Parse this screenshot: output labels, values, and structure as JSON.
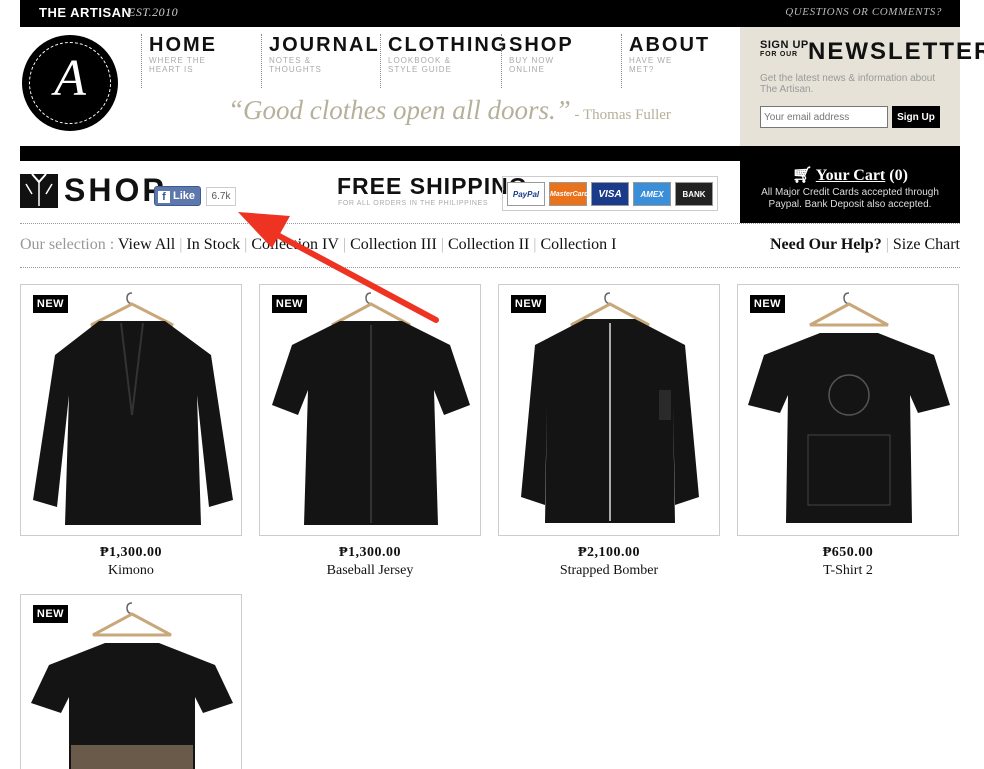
{
  "top_bar": {
    "brand": "THE ARTISAN",
    "est": "EST.2010",
    "questions": "QUESTIONS OR COMMENTS?"
  },
  "logo": {
    "letter": "A"
  },
  "nav": [
    {
      "title": "HOME",
      "sub1": "WHERE THE",
      "sub2": "HEART IS"
    },
    {
      "title": "JOURNAL",
      "sub1": "NOTES &",
      "sub2": "THOUGHTS"
    },
    {
      "title": "CLOTHING",
      "sub1": "LOOKBOOK &",
      "sub2": "STYLE GUIDE"
    },
    {
      "title": "SHOP",
      "sub1": "BUY NOW",
      "sub2": "ONLINE"
    },
    {
      "title": "ABOUT",
      "sub1": "HAVE WE",
      "sub2": "MET?"
    }
  ],
  "quote": {
    "text": "“Good clothes open all doors.”",
    "author": " - Thomas Fuller"
  },
  "newsletter": {
    "signup": "SIGN UP",
    "for_our": "FOR OUR",
    "title": "NEWSLETTER",
    "desc": "Get the latest news & information about The Artisan.",
    "placeholder": "Your email address",
    "button": "Sign Up"
  },
  "shop": {
    "title": "SHOP",
    "fb_like": "Like",
    "fb_count": "6.7k",
    "shipping_title": "FREE SHIPPING",
    "shipping_sub": "FOR ALL ORDERS IN THE PHILIPPINES",
    "payments": [
      "PayPal",
      "MasterCard",
      "VISA",
      "AMEX",
      "BANK"
    ]
  },
  "cart": {
    "label": "Your Cart",
    "count": "(0)",
    "note": "All Major Credit Cards accepted through Paypal. Bank Deposit also accepted."
  },
  "filters": {
    "label": "Our selection :",
    "links": [
      "View All",
      "In Stock",
      "Collection IV",
      "Collection III",
      "Collection II",
      "Collection I"
    ],
    "help": "Need Our Help?",
    "size_chart": "Size Chart"
  },
  "products": [
    {
      "tag": "NEW",
      "price": "₱1,300.00",
      "name": "Kimono"
    },
    {
      "tag": "NEW",
      "price": "₱1,300.00",
      "name": "Baseball Jersey"
    },
    {
      "tag": "NEW",
      "price": "₱2,100.00",
      "name": "Strapped Bomber"
    },
    {
      "tag": "NEW",
      "price": "₱650.00",
      "name": "T-Shirt 2"
    },
    {
      "tag": "NEW",
      "price": "",
      "name": ""
    }
  ],
  "colors": {
    "black": "#000000",
    "quote": "#b5b09a",
    "newsletter_bg": "#e6e2d8",
    "annotation_arrow": "#ee3322"
  }
}
